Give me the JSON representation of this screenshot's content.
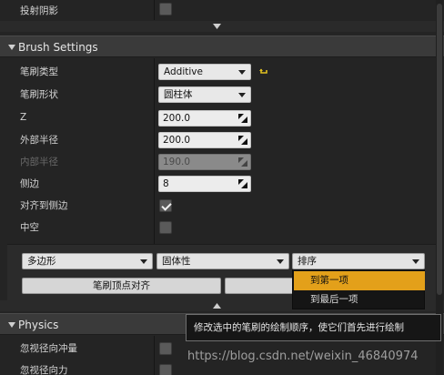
{
  "top_rows": {
    "cast_shadow_label": "投射阴影"
  },
  "brush_settings": {
    "title": "Brush Settings",
    "brush_type": {
      "label": "笔刷类型",
      "value": "Additive"
    },
    "brush_shape": {
      "label": "笔刷形状",
      "value": "圆柱体"
    },
    "z": {
      "label": "Z",
      "value": "200.0"
    },
    "outer_radius": {
      "label": "外部半径",
      "value": "200.0"
    },
    "inner_radius": {
      "label": "内部半径",
      "value": "190.0"
    },
    "sides": {
      "label": "侧边",
      "value": "8"
    },
    "align_to_side": {
      "label": "对齐到侧边",
      "checked": true
    },
    "hollow": {
      "label": "中空",
      "checked": false
    }
  },
  "tools": {
    "polygon_combo": "多边形",
    "solidity_combo": "固体性",
    "order_combo": "排序",
    "align_vertices_button": "笔刷顶点对齐",
    "order_menu": [
      {
        "label": "到第一项",
        "selected": true
      },
      {
        "label": "到最后一项",
        "selected": false
      }
    ]
  },
  "physics": {
    "title": "Physics",
    "ignore_radial_impulse": {
      "label": "忽视径向冲量",
      "checked": false
    },
    "ignore_radial_force": {
      "label": "忽视径向力",
      "checked": false
    }
  },
  "tooltip": "修改选中的笔刷的绘制顺序，使它们首先进行绘制",
  "watermark": "https://blog.csdn.net/weixin_46840974",
  "colors": {
    "menu_highlight": "#e3a01a",
    "panel_bg": "#242424",
    "section_bg": "#3a3a3a"
  }
}
